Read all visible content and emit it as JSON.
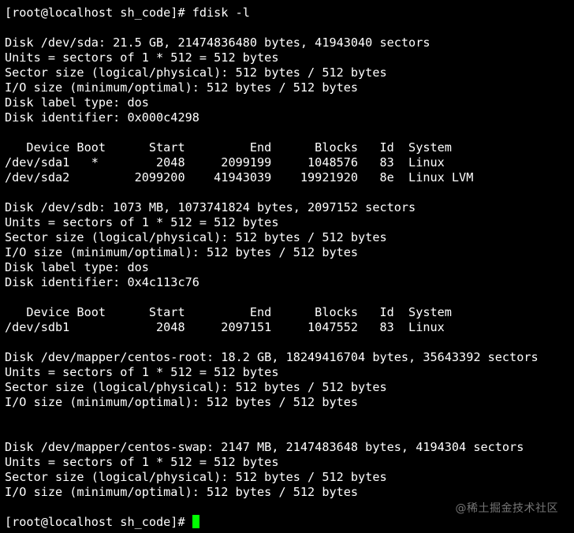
{
  "terminal": {
    "lines": [
      "[root@localhost sh_code]# fdisk -l",
      "",
      "Disk /dev/sda: 21.5 GB, 21474836480 bytes, 41943040 sectors",
      "Units = sectors of 1 * 512 = 512 bytes",
      "Sector size (logical/physical): 512 bytes / 512 bytes",
      "I/O size (minimum/optimal): 512 bytes / 512 bytes",
      "Disk label type: dos",
      "Disk identifier: 0x000c4298",
      "",
      "   Device Boot      Start         End      Blocks   Id  System",
      "/dev/sda1   *        2048     2099199     1048576   83  Linux",
      "/dev/sda2         2099200    41943039    19921920   8e  Linux LVM",
      "",
      "Disk /dev/sdb: 1073 MB, 1073741824 bytes, 2097152 sectors",
      "Units = sectors of 1 * 512 = 512 bytes",
      "Sector size (logical/physical): 512 bytes / 512 bytes",
      "I/O size (minimum/optimal): 512 bytes / 512 bytes",
      "Disk label type: dos",
      "Disk identifier: 0x4c113c76",
      "",
      "   Device Boot      Start         End      Blocks   Id  System",
      "/dev/sdb1            2048     2097151     1047552   83  Linux",
      "",
      "Disk /dev/mapper/centos-root: 18.2 GB, 18249416704 bytes, 35643392 sectors",
      "Units = sectors of 1 * 512 = 512 bytes",
      "Sector size (logical/physical): 512 bytes / 512 bytes",
      "I/O size (minimum/optimal): 512 bytes / 512 bytes",
      "",
      "",
      "Disk /dev/mapper/centos-swap: 2147 MB, 2147483648 bytes, 4194304 sectors",
      "Units = sectors of 1 * 512 = 512 bytes",
      "Sector size (logical/physical): 512 bytes / 512 bytes",
      "I/O size (minimum/optimal): 512 bytes / 512 bytes",
      ""
    ],
    "prompt": "[root@localhost sh_code]# ",
    "colors": {
      "background": "#000000",
      "foreground": "#ffffff",
      "cursor": "#00ff00",
      "watermark": "#8a8a8a"
    }
  },
  "watermark": {
    "text": "@稀土掘金技术社区"
  }
}
